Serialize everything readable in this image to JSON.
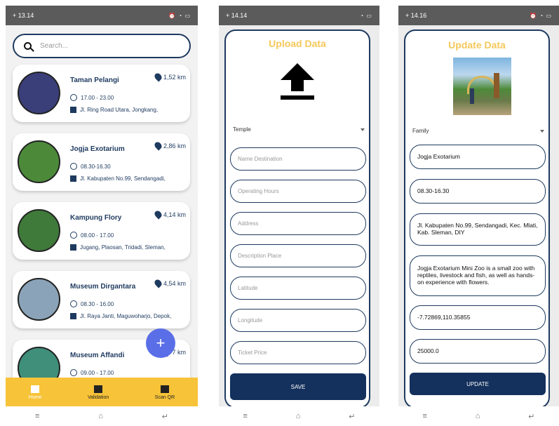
{
  "phone1": {
    "status": {
      "time": "+ 13.14"
    },
    "search": {
      "placeholder": "Search..."
    },
    "cards": [
      {
        "name": "Taman Pelangi",
        "distance": "1,52 km",
        "hours": "17.00 - 23.00",
        "address": "Jl. Ring Road Utara, Jongkang,",
        "thumb_color": "#3a3f7a"
      },
      {
        "name": "Jogja Exotarium",
        "distance": "2,86 km",
        "hours": "08.30-16.30",
        "address": "Jl. Kabupaten No.99, Sendangadi,",
        "thumb_color": "#4c8a3a"
      },
      {
        "name": "Kampung Flory",
        "distance": "4,14 km",
        "hours": "08.00 - 17.00",
        "address": "Jugang, Plaosan, Tridadi, Sleman,",
        "thumb_color": "#3f7a3a"
      },
      {
        "name": "Museum Dirgantara",
        "distance": "4,54 km",
        "hours": "08.30 - 16.00",
        "address": "Jl. Raya Janti, Maguwoharjo, Depok,",
        "thumb_color": "#8aa3b8"
      },
      {
        "name": "Museum Affandi",
        "distance": "7 km",
        "hours": "09.00 - 17.00",
        "address": "",
        "thumb_color": "#3f8f7a"
      }
    ],
    "fab": "+",
    "bottom_nav": [
      {
        "label": "Home",
        "icon": "home-icon",
        "active": true
      },
      {
        "label": "Validation",
        "icon": "validation-icon",
        "active": false
      },
      {
        "label": "Scan QR",
        "icon": "qr-icon",
        "active": false
      }
    ],
    "accent": "#f7c338"
  },
  "phone2": {
    "status": {
      "time": "+ 14.14"
    },
    "title": "Upload Data",
    "category": "Temple",
    "fields": [
      "Name Destination",
      "Operating Hours",
      "Address",
      "Description Place",
      "Latitude",
      "Longitude",
      "Ticket Price"
    ],
    "button": "SAVE"
  },
  "phone3": {
    "status": {
      "time": "+ 14.16"
    },
    "title": "Update Data",
    "category": "Family",
    "values": [
      "Jogja Exotarium",
      "08.30-16.30",
      "Jl. Kabupaten No.99, Sendangadi, Kec. Mlati, Kab. Sleman, DIY",
      "Jogja Exotarium Mini Zoo is a small zoo with reptiles, livestock and fish, as well as hands-on experience with flowers.",
      "-7.72869,110.35855",
      "25000.0"
    ],
    "button": "UPDATE"
  },
  "nav_glyphs": [
    "≡",
    "⌂",
    "↵"
  ],
  "colors": {
    "navy": "#1e3a5f",
    "button": "#14305c",
    "title_yellow": "#f5c85a",
    "fab": "#5a6ee8"
  }
}
